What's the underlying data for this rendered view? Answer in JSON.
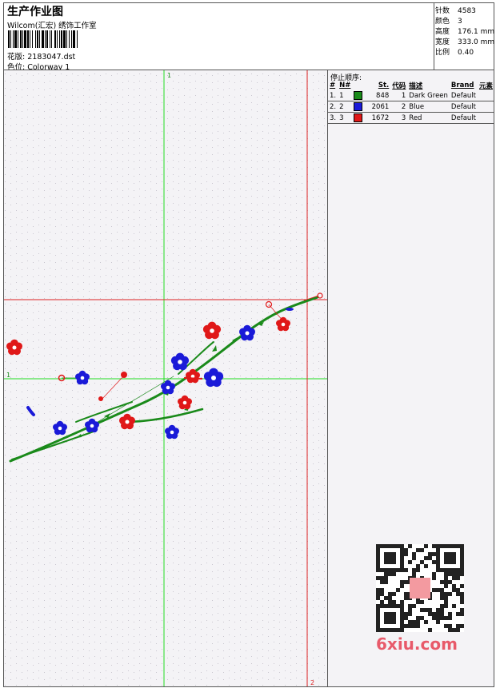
{
  "header": {
    "title": "生产作业图",
    "company": "Wilcom(汇宏) 绣饰工作室",
    "design_file_label": "花版:",
    "design_file": "2183047.dst",
    "colorway_label": "色位:",
    "colorway": "Colorway 1"
  },
  "stats": [
    {
      "label": "针数",
      "value": "4583"
    },
    {
      "label": "颜色",
      "value": "3"
    },
    {
      "label": "高度",
      "value": "176.1 mm"
    },
    {
      "label": "宽度",
      "value": "333.0 mm"
    },
    {
      "label": "比例",
      "value": "0.40"
    }
  ],
  "stop_sequence": {
    "title": "停止顺序:",
    "columns": [
      "#",
      "N#",
      "St.",
      "代码",
      "描述",
      "Brand",
      "元素"
    ],
    "rows": [
      {
        "index": "1.",
        "n": "1",
        "color": "#1a8a1a",
        "stitches": "848",
        "code": "1",
        "desc": "Dark Green",
        "brand": "Default"
      },
      {
        "index": "2.",
        "n": "2",
        "color": "#1a1ad8",
        "stitches": "2061",
        "code": "2",
        "desc": "Blue",
        "brand": "Default"
      },
      {
        "index": "3.",
        "n": "3",
        "color": "#e01818",
        "stitches": "1672",
        "code": "3",
        "desc": "Red",
        "brand": "Default"
      }
    ]
  },
  "canvas": {
    "guide_labels": {
      "v_top": "1",
      "h_left": "1",
      "v_bottom": "2"
    },
    "colors": {
      "guide_green": "#22dd22",
      "guide_red": "#dd2222",
      "stem": "#1a8a1a",
      "blue": "#1a1ad8",
      "red": "#e01818"
    }
  },
  "watermark": {
    "site": "6xiu.com"
  }
}
